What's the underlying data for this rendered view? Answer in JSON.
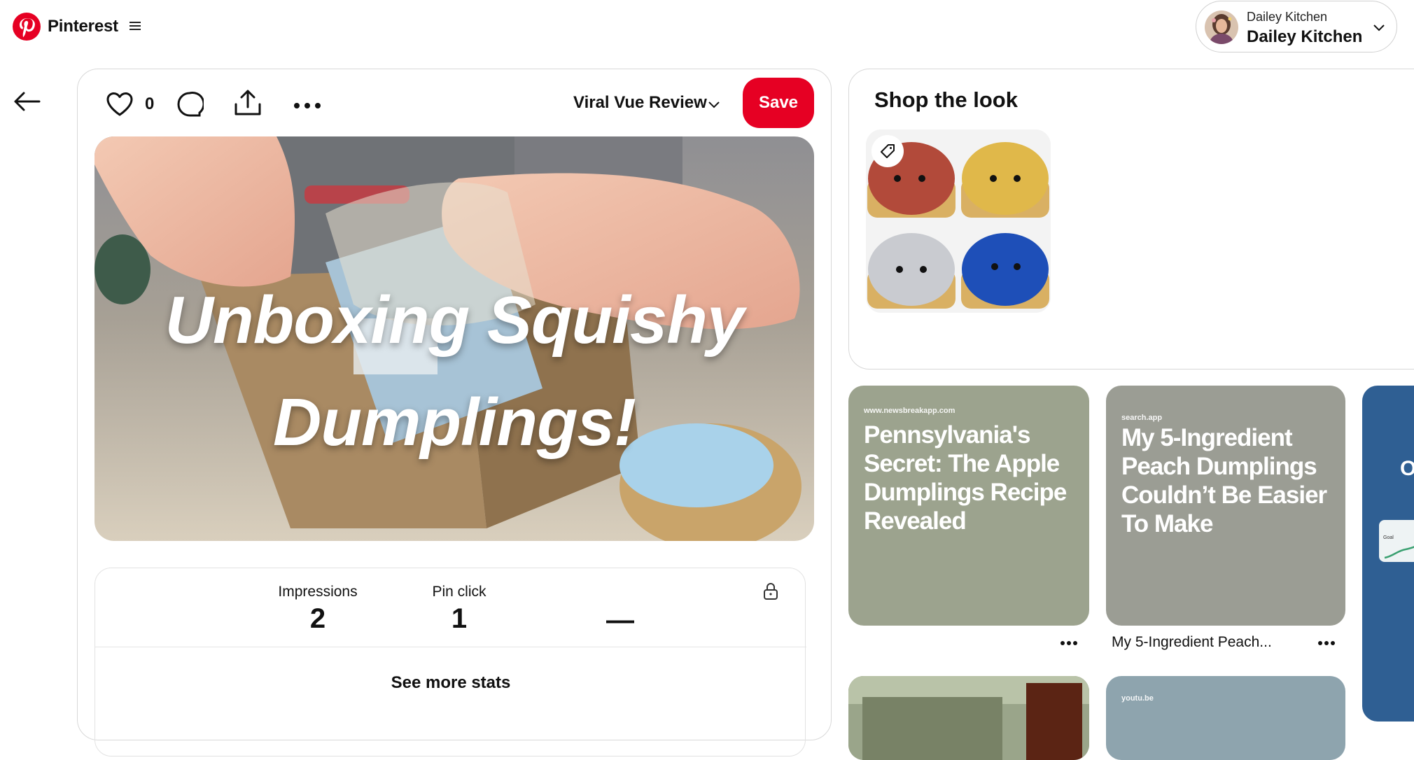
{
  "app": {
    "brand": "Pinterest"
  },
  "account": {
    "label_small": "Dailey Kitchen",
    "label_big": "Dailey Kitchen"
  },
  "pin": {
    "like_count": "0",
    "board_name": "Viral Vue Review",
    "save_label": "Save",
    "image_title": "Unboxing Squishy Dumplings!",
    "stats": {
      "impressions_label": "Impressions",
      "impressions_value": "2",
      "pin_click_label": "Pin click",
      "pin_click_value": "1",
      "third_value": "—",
      "see_more_label": "See more stats"
    }
  },
  "shop": {
    "title": "Shop the look"
  },
  "related": [
    {
      "domain": "www.newsbreakapp.com",
      "title": "Pennsylvania's Secret: The Apple Dumplings Recipe Revealed",
      "caption": ""
    },
    {
      "domain": "search.app",
      "title": "My 5-Ingredient Peach Dumplings Couldn’t Be Easier To Make",
      "caption": "My 5-Ingredient Peach..."
    },
    {
      "letter": "O",
      "card_label": "Goal"
    },
    {
      "domain": "youtu.be"
    }
  ],
  "colors": {
    "brand_red": "#e60023",
    "pin_green": "#9ca38e",
    "pin_grey": "#9b9d94",
    "pin_blue": "#2f5f93"
  },
  "icons": [
    "pinterest-logo-icon",
    "hamburger-menu-icon",
    "chevron-down-icon",
    "back-arrow-icon",
    "heart-icon",
    "comment-icon",
    "share-icon",
    "more-options-icon",
    "lock-icon",
    "tag-icon"
  ]
}
